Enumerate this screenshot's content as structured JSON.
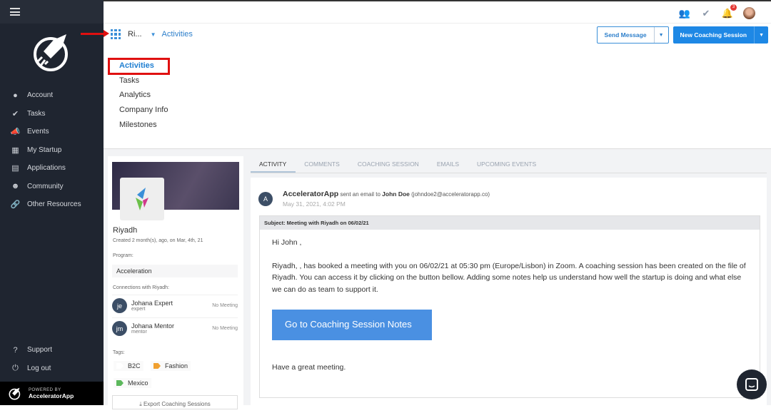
{
  "sidebar": {
    "items": [
      {
        "label": "Account",
        "icon": "user-icon"
      },
      {
        "label": "Tasks",
        "icon": "check-circle-icon"
      },
      {
        "label": "Events",
        "icon": "megaphone-icon"
      },
      {
        "label": "My Startup",
        "icon": "building-icon"
      },
      {
        "label": "Applications",
        "icon": "applications-icon"
      },
      {
        "label": "Community",
        "icon": "community-icon"
      },
      {
        "label": "Other Resources",
        "icon": "link-icon"
      }
    ],
    "bottom": [
      {
        "label": "Support",
        "icon": "question-icon"
      },
      {
        "label": "Log out",
        "icon": "power-icon"
      }
    ],
    "powered_by": "POWERED BY",
    "brand": "AcceleratorApp"
  },
  "topbar": {
    "notification_count": "3"
  },
  "breadcrumb": {
    "company": "Ri...",
    "page": "Activities"
  },
  "actions": {
    "send_message": "Send Message",
    "new_session": "New Coaching Session"
  },
  "subnav": [
    "Activities",
    "Tasks",
    "Analytics",
    "Company Info",
    "Milestones"
  ],
  "company": {
    "name": "Riyadh",
    "created": "Created 2 month(s), ago, on Mar, 4th, 21",
    "program_label": "Program:",
    "program": "Acceleration",
    "connections_label": "Connections with Riyadh:",
    "connections": [
      {
        "initials": "je",
        "name": "Johana Expert",
        "role": "expert",
        "status": "No Meeting"
      },
      {
        "initials": "jm",
        "name": "Johana Mentor",
        "role": "mentor",
        "status": "No Meeting"
      }
    ],
    "tags_label": "Tags:",
    "tags": [
      "B2C",
      "Fashion",
      "Mexico"
    ],
    "export": "Export Coaching Sessions"
  },
  "tabs": [
    "ACTIVITY",
    "COMMENTS",
    "COACHING SESSION",
    "EMAILS",
    "UPCOMING EVENTS"
  ],
  "activity": {
    "avatar": "A",
    "sender": "AcceleratorApp",
    "action": "sent an email to",
    "recipient": "John Doe",
    "email": "(johndoe2@acceleratorapp.co)",
    "date": "May 31, 2021, 4:02 PM",
    "subject": "Subject: Meeting with Riyadh on 06/02/21",
    "greeting": "Hi John ,",
    "body": "Riyadh, , has booked a meeting with you on 06/02/21 at 05:30 pm (Europe/Lisbon) in Zoom. A coaching session has been created on the file of Riyadh. You can access it by clicking on the button bellow. Adding some notes help us understand how well the startup is doing and what else we can do as team to support it.",
    "button": "Go to Coaching Session Notes",
    "closing": "Have a great meeting."
  },
  "colors": {
    "accent": "#1e88e5",
    "sidebar": "#1f2530",
    "highlight": "#e01010"
  }
}
